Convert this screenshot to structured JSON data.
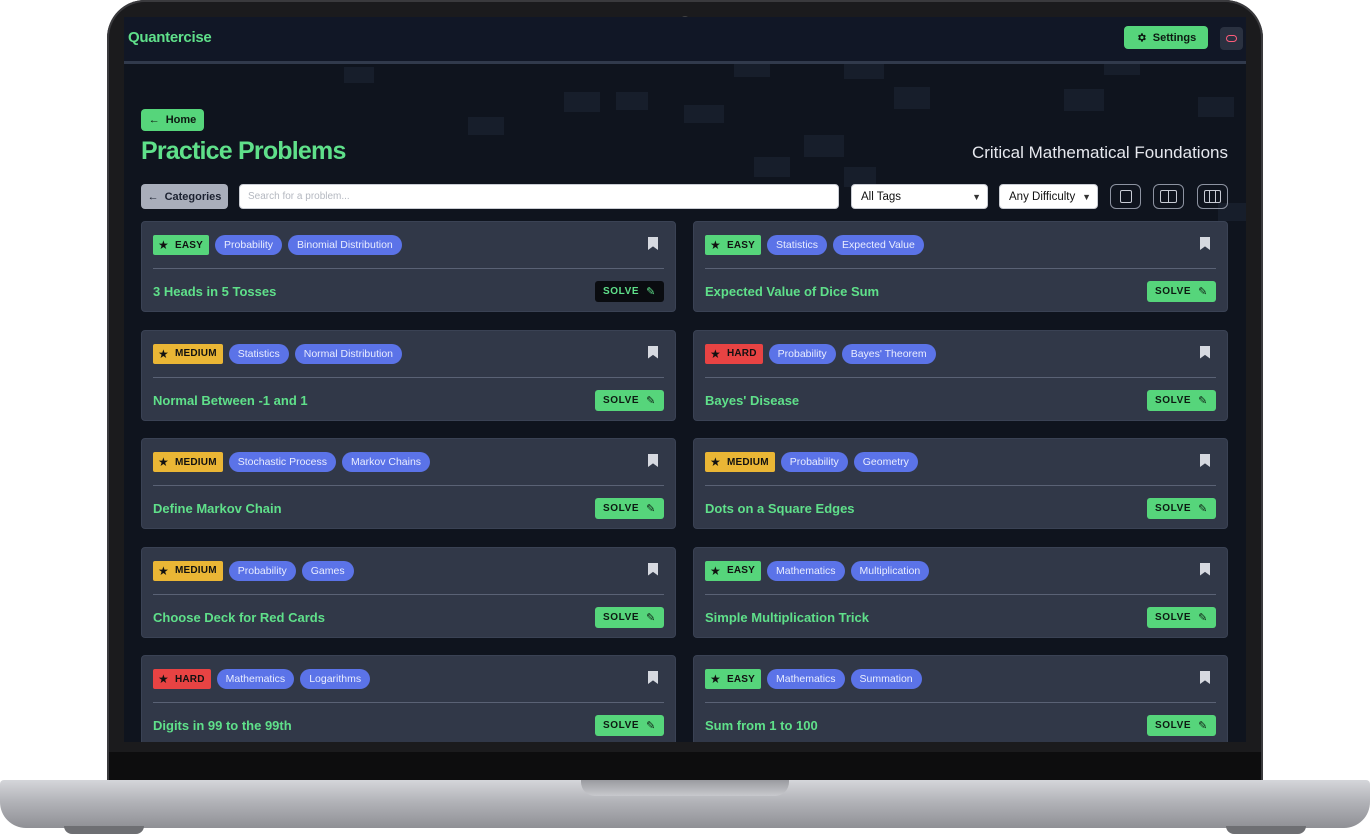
{
  "app": {
    "brand": "Quantercise",
    "settings_label": "Settings"
  },
  "icons": {
    "settings": "gear-icon",
    "theme": "toggle-icon",
    "back": "arrow-left-icon",
    "bookmark": "bookmark-icon",
    "solve": "pencil-icon",
    "difficulty": "star-icon"
  },
  "nav": {
    "home_label": "Home",
    "categories_label": "Categories"
  },
  "page": {
    "title": "Practice Problems",
    "subtitle": "Critical Mathematical Foundations"
  },
  "filters": {
    "search_placeholder": "Search for a problem...",
    "tags_selected": "All Tags",
    "difficulty_selected": "Any Difficulty"
  },
  "colors": {
    "accent": "#56d57b",
    "easy": "#56d57b",
    "medium": "#eab635",
    "hard": "#e84343",
    "tag": "#5b73e8"
  },
  "problems": [
    {
      "difficulty": "EASY",
      "tags": [
        "Probability",
        "Binomial Distribution"
      ],
      "title": "3 Heads in 5 Tosses",
      "solve": "SOLVE"
    },
    {
      "difficulty": "EASY",
      "tags": [
        "Statistics",
        "Expected Value"
      ],
      "title": "Expected Value of Dice Sum",
      "solve": "SOLVE"
    },
    {
      "difficulty": "MEDIUM",
      "tags": [
        "Statistics",
        "Normal Distribution"
      ],
      "title": "Normal Between -1 and 1",
      "solve": "SOLVE"
    },
    {
      "difficulty": "HARD",
      "tags": [
        "Probability",
        "Bayes' Theorem"
      ],
      "title": "Bayes' Disease",
      "solve": "SOLVE"
    },
    {
      "difficulty": "MEDIUM",
      "tags": [
        "Stochastic Process",
        "Markov Chains"
      ],
      "title": "Define Markov Chain",
      "solve": "SOLVE"
    },
    {
      "difficulty": "MEDIUM",
      "tags": [
        "Probability",
        "Geometry"
      ],
      "title": "Dots on a Square Edges",
      "solve": "SOLVE"
    },
    {
      "difficulty": "MEDIUM",
      "tags": [
        "Probability",
        "Games"
      ],
      "title": "Choose Deck for Red Cards",
      "solve": "SOLVE"
    },
    {
      "difficulty": "EASY",
      "tags": [
        "Mathematics",
        "Multiplication"
      ],
      "title": "Simple Multiplication Trick",
      "solve": "SOLVE"
    },
    {
      "difficulty": "HARD",
      "tags": [
        "Mathematics",
        "Logarithms"
      ],
      "title": "Digits in 99 to the 99th",
      "solve": "SOLVE"
    },
    {
      "difficulty": "EASY",
      "tags": [
        "Mathematics",
        "Summation"
      ],
      "title": "Sum from 1 to 100",
      "solve": "SOLVE"
    }
  ]
}
